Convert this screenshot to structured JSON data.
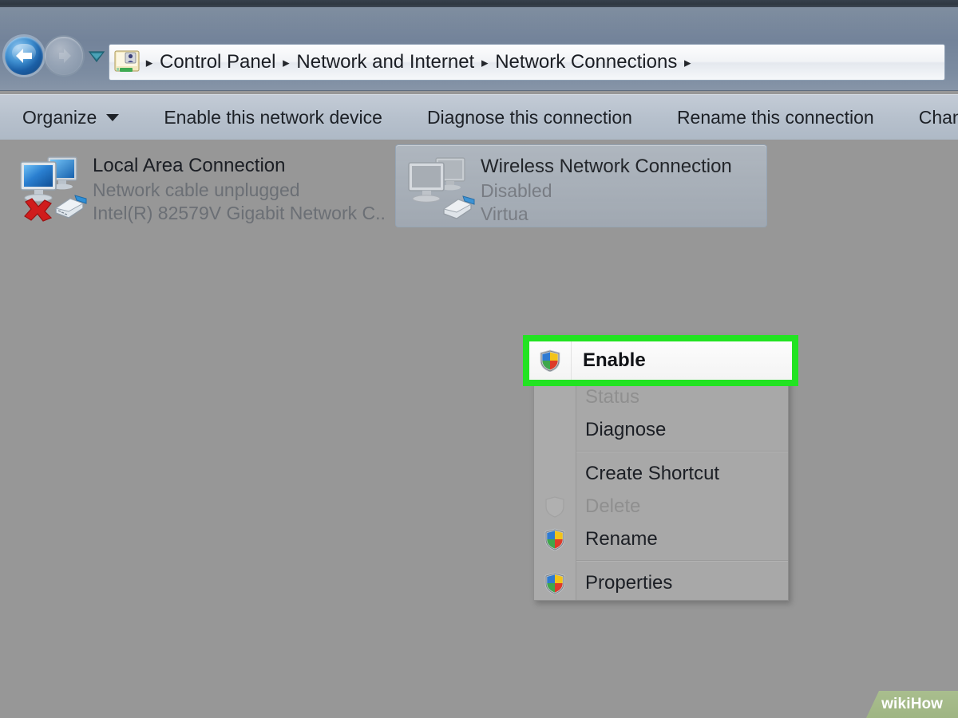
{
  "window": {
    "title": "Network Connections"
  },
  "nav": {
    "back_label": "Back",
    "forward_label": "Forward",
    "recent_pages_label": "Recent pages",
    "back_icon": "back-arrow-icon",
    "forward_icon": "forward-arrow-icon",
    "recent_icon": "chevron-down-icon"
  },
  "address": {
    "icon": "control-panel-network-icon",
    "crumbs": [
      {
        "label": "Control Panel"
      },
      {
        "label": "Network and Internet"
      },
      {
        "label": "Network Connections"
      }
    ],
    "separator": "▸"
  },
  "toolbar": {
    "organize_label": "Organize",
    "organize_caret": "▼",
    "items": [
      {
        "label": "Enable this network device"
      },
      {
        "label": "Diagnose this connection"
      },
      {
        "label": "Rename this connection"
      },
      {
        "label": "Change s"
      }
    ]
  },
  "connections": [
    {
      "name": "Local Area Connection",
      "status": "Network cable unplugged",
      "device": "Intel(R) 82579V Gigabit Network C...",
      "icon": "network-adapter-unplugged-icon",
      "selected": false
    },
    {
      "name": "Wireless Network Connection",
      "status": "Disabled",
      "device": "Virtua",
      "icon": "network-adapter-disabled-icon",
      "selected": true
    }
  ],
  "context_menu": {
    "highlight_color": "#22e322",
    "items": [
      {
        "label": "Enable",
        "icon": "uac-shield-icon",
        "disabled": false,
        "highlighted": true,
        "bold": true
      },
      {
        "label": "Status",
        "icon": null,
        "disabled": true,
        "highlighted": false,
        "bold": false
      },
      {
        "label": "Diagnose",
        "icon": null,
        "disabled": false,
        "highlighted": false,
        "bold": false
      },
      {
        "label": "Create Shortcut",
        "icon": null,
        "disabled": false,
        "highlighted": false,
        "bold": false
      },
      {
        "label": "Delete",
        "icon": "uac-shield-icon",
        "disabled": true,
        "highlighted": false,
        "bold": false
      },
      {
        "label": "Rename",
        "icon": "uac-shield-icon",
        "disabled": false,
        "highlighted": false,
        "bold": false
      },
      {
        "label": "Properties",
        "icon": "uac-shield-icon",
        "disabled": false,
        "highlighted": false,
        "bold": false
      }
    ]
  },
  "watermark": {
    "wiki": "wiki",
    "how": "How"
  }
}
